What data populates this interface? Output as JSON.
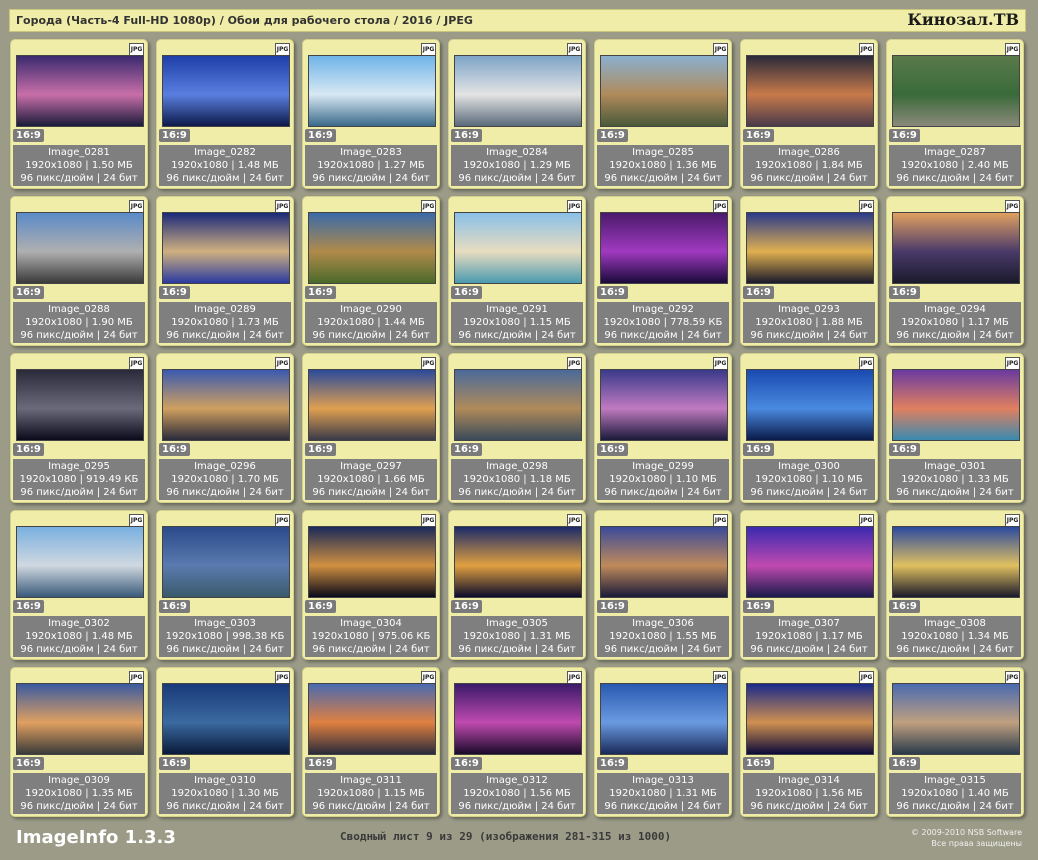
{
  "header": {
    "title": "Города (Часть-4 Full-HD 1080p) / Обои для рабочего стола / 2016 / JPEG",
    "brand": "Кинозал.ТВ"
  },
  "file_badge": "JPG",
  "images": [
    {
      "name": "Image_0281",
      "res": "1920x1080",
      "size": "1.50 МБ",
      "dpi": "96 пикс/дюйм | 24 бит",
      "ratio": "16:9",
      "colors": [
        "#3a2a6e",
        "#c86fa8",
        "#1b1b3a"
      ]
    },
    {
      "name": "Image_0282",
      "res": "1920x1080",
      "size": "1.48 МБ",
      "dpi": "96 пикс/дюйм | 24 бит",
      "ratio": "16:9",
      "colors": [
        "#1e3fa8",
        "#5a7fe0",
        "#0d1a4a"
      ]
    },
    {
      "name": "Image_0283",
      "res": "1920x1080",
      "size": "1.27 МБ",
      "dpi": "96 пикс/дюйм | 24 бит",
      "ratio": "16:9",
      "colors": [
        "#6fb4e8",
        "#d8e8f4",
        "#3a6a8a"
      ]
    },
    {
      "name": "Image_0284",
      "res": "1920x1080",
      "size": "1.29 МБ",
      "dpi": "96 пикс/дюйм | 24 бит",
      "ratio": "16:9",
      "colors": [
        "#7ea4c8",
        "#e4e4e4",
        "#5a6a7a"
      ]
    },
    {
      "name": "Image_0285",
      "res": "1920x1080",
      "size": "1.36 МБ",
      "dpi": "96 пикс/дюйм | 24 бит",
      "ratio": "16:9",
      "colors": [
        "#8ab0d0",
        "#b08a5a",
        "#4a5a3a"
      ]
    },
    {
      "name": "Image_0286",
      "res": "1920x1080",
      "size": "1.84 МБ",
      "dpi": "96 пикс/дюйм | 24 бит",
      "ratio": "16:9",
      "colors": [
        "#2a2a3a",
        "#c87a4a",
        "#4a3a4a"
      ]
    },
    {
      "name": "Image_0287",
      "res": "1920x1080",
      "size": "2.40 МБ",
      "dpi": "96 пикс/дюйм | 24 бит",
      "ratio": "16:9",
      "colors": [
        "#5a7a4a",
        "#3a6a3a",
        "#8a8a7a"
      ]
    },
    {
      "name": "Image_0288",
      "res": "1920x1080",
      "size": "1.90 МБ",
      "dpi": "96 пикс/дюйм | 24 бит",
      "ratio": "16:9",
      "colors": [
        "#5a8ac8",
        "#b0b0b0",
        "#3a3a3a"
      ]
    },
    {
      "name": "Image_0289",
      "res": "1920x1080",
      "size": "1.73 МБ",
      "dpi": "96 пикс/дюйм | 24 бит",
      "ratio": "16:9",
      "colors": [
        "#1a2a7a",
        "#d0b080",
        "#2a3aa0"
      ]
    },
    {
      "name": "Image_0290",
      "res": "1920x1080",
      "size": "1.44 МБ",
      "dpi": "96 пикс/дюйм | 24 бит",
      "ratio": "16:9",
      "colors": [
        "#3a6aa8",
        "#b08a4a",
        "#4a6a2a"
      ]
    },
    {
      "name": "Image_0291",
      "res": "1920x1080",
      "size": "1.15 МБ",
      "dpi": "96 пикс/дюйм | 24 бит",
      "ratio": "16:9",
      "colors": [
        "#8ac0e8",
        "#e8dcc0",
        "#4a9ab0"
      ]
    },
    {
      "name": "Image_0292",
      "res": "1920x1080",
      "size": "778.59 КБ",
      "dpi": "96 пикс/дюйм | 24 бит",
      "ratio": "16:9",
      "colors": [
        "#4a1a6a",
        "#a03ac0",
        "#1a0a3a"
      ]
    },
    {
      "name": "Image_0293",
      "res": "1920x1080",
      "size": "1.88 МБ",
      "dpi": "96 пикс/дюйм | 24 бит",
      "ratio": "16:9",
      "colors": [
        "#2a3a8a",
        "#e0b050",
        "#1a1a2a"
      ]
    },
    {
      "name": "Image_0294",
      "res": "1920x1080",
      "size": "1.17 МБ",
      "dpi": "96 пикс/дюйм | 24 бит",
      "ratio": "16:9",
      "colors": [
        "#e0a060",
        "#4a3a6a",
        "#1a1a2a"
      ]
    },
    {
      "name": "Image_0295",
      "res": "1920x1080",
      "size": "919.49 КБ",
      "dpi": "96 пикс/дюйм | 24 бит",
      "ratio": "16:9",
      "colors": [
        "#2a2a3a",
        "#6a6a7a",
        "#0a0a1a"
      ]
    },
    {
      "name": "Image_0296",
      "res": "1920x1080",
      "size": "1.70 МБ",
      "dpi": "96 пикс/дюйм | 24 бит",
      "ratio": "16:9",
      "colors": [
        "#3a5ab0",
        "#d0a060",
        "#2a2a3a"
      ]
    },
    {
      "name": "Image_0297",
      "res": "1920x1080",
      "size": "1.66 МБ",
      "dpi": "96 пикс/дюйм | 24 бит",
      "ratio": "16:9",
      "colors": [
        "#2a4a9a",
        "#e0a050",
        "#3a3a4a"
      ]
    },
    {
      "name": "Image_0298",
      "res": "1920x1080",
      "size": "1.18 МБ",
      "dpi": "96 пикс/дюйм | 24 бит",
      "ratio": "16:9",
      "colors": [
        "#4a6a9a",
        "#b08a5a",
        "#3a4a5a"
      ]
    },
    {
      "name": "Image_0299",
      "res": "1920x1080",
      "size": "1.10 МБ",
      "dpi": "96 пикс/дюйм | 24 бит",
      "ratio": "16:9",
      "colors": [
        "#3a3a8a",
        "#c07ac0",
        "#1a1a3a"
      ]
    },
    {
      "name": "Image_0300",
      "res": "1920x1080",
      "size": "1.10 МБ",
      "dpi": "96 пикс/дюйм | 24 бит",
      "ratio": "16:9",
      "colors": [
        "#1a4ab0",
        "#4a8ae0",
        "#0a1a4a"
      ]
    },
    {
      "name": "Image_0301",
      "res": "1920x1080",
      "size": "1.33 МБ",
      "dpi": "96 пикс/дюйм | 24 бит",
      "ratio": "16:9",
      "colors": [
        "#6a3aa0",
        "#e08060",
        "#3a8ab0"
      ]
    },
    {
      "name": "Image_0302",
      "res": "1920x1080",
      "size": "1.48 МБ",
      "dpi": "96 пикс/дюйм | 24 бит",
      "ratio": "16:9",
      "colors": [
        "#7ab0e0",
        "#d0d8e0",
        "#3a5a7a"
      ]
    },
    {
      "name": "Image_0303",
      "res": "1920x1080",
      "size": "998.38 КБ",
      "dpi": "96 пикс/дюйм | 24 бит",
      "ratio": "16:9",
      "colors": [
        "#2a4a8a",
        "#5a7ab0",
        "#3a5a6a"
      ]
    },
    {
      "name": "Image_0304",
      "res": "1920x1080",
      "size": "975.06 КБ",
      "dpi": "96 пикс/дюйм | 24 бит",
      "ratio": "16:9",
      "colors": [
        "#1a2a5a",
        "#d09040",
        "#0a0a1a"
      ]
    },
    {
      "name": "Image_0305",
      "res": "1920x1080",
      "size": "1.31 МБ",
      "dpi": "96 пикс/дюйм | 24 бит",
      "ratio": "16:9",
      "colors": [
        "#1a2a6a",
        "#e0a040",
        "#0a0a2a"
      ]
    },
    {
      "name": "Image_0306",
      "res": "1920x1080",
      "size": "1.55 МБ",
      "dpi": "96 пикс/дюйм | 24 бит",
      "ratio": "16:9",
      "colors": [
        "#3a4a9a",
        "#c08a5a",
        "#1a1a3a"
      ]
    },
    {
      "name": "Image_0307",
      "res": "1920x1080",
      "size": "1.17 МБ",
      "dpi": "96 пикс/дюйм | 24 бит",
      "ratio": "16:9",
      "colors": [
        "#3a2ab0",
        "#c04ab0",
        "#1a1a4a"
      ]
    },
    {
      "name": "Image_0308",
      "res": "1920x1080",
      "size": "1.34 МБ",
      "dpi": "96 пикс/дюйм | 24 бит",
      "ratio": "16:9",
      "colors": [
        "#2a4aa0",
        "#e0c060",
        "#1a1a2a"
      ]
    },
    {
      "name": "Image_0309",
      "res": "1920x1080",
      "size": "1.35 МБ",
      "dpi": "96 пикс/дюйм | 24 бит",
      "ratio": "16:9",
      "colors": [
        "#3a5aa0",
        "#e0a060",
        "#3a3a3a"
      ]
    },
    {
      "name": "Image_0310",
      "res": "1920x1080",
      "size": "1.30 МБ",
      "dpi": "96 пикс/дюйм | 24 бит",
      "ratio": "16:9",
      "colors": [
        "#1a3a7a",
        "#3a6aa0",
        "#0a1a3a"
      ]
    },
    {
      "name": "Image_0311",
      "res": "1920x1080",
      "size": "1.15 МБ",
      "dpi": "96 пикс/дюйм | 24 бит",
      "ratio": "16:9",
      "colors": [
        "#4a6ab0",
        "#e08040",
        "#2a2a3a"
      ]
    },
    {
      "name": "Image_0312",
      "res": "1920x1080",
      "size": "1.56 МБ",
      "dpi": "96 пикс/дюйм | 24 бит",
      "ratio": "16:9",
      "colors": [
        "#3a1a6a",
        "#c04ab0",
        "#1a0a2a"
      ]
    },
    {
      "name": "Image_0313",
      "res": "1920x1080",
      "size": "1.31 МБ",
      "dpi": "96 пикс/дюйм | 24 бит",
      "ratio": "16:9",
      "colors": [
        "#2a5ab0",
        "#6a9ae0",
        "#1a2a5a"
      ]
    },
    {
      "name": "Image_0314",
      "res": "1920x1080",
      "size": "1.56 МБ",
      "dpi": "96 пикс/дюйм | 24 бит",
      "ratio": "16:9",
      "colors": [
        "#1a2a8a",
        "#d09050",
        "#0a0a3a"
      ]
    },
    {
      "name": "Image_0315",
      "res": "1920x1080",
      "size": "1.40 МБ",
      "dpi": "96 пикс/дюйм | 24 бит",
      "ratio": "16:9",
      "colors": [
        "#4a6ab0",
        "#c0a080",
        "#2a3a4a"
      ]
    }
  ],
  "footer": {
    "app": "ImageInfo 1.3.3",
    "sheet": "Сводный лист 9 из 29 (изображения 281-315 из 1000)",
    "copyright1": "© 2009-2010 NSB Software",
    "copyright2": "Все права защищены"
  }
}
